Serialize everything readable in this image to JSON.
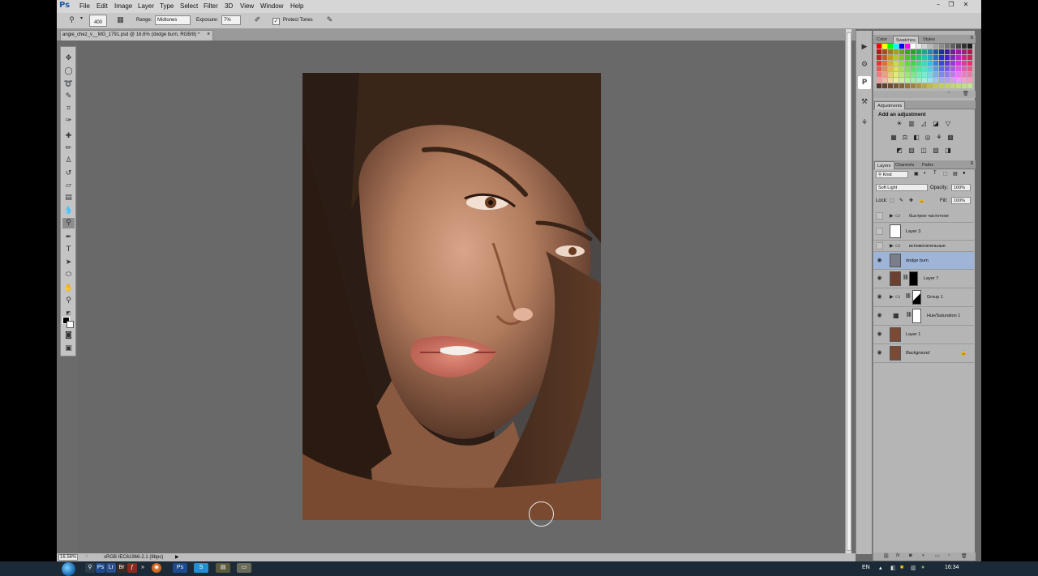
{
  "menu": {
    "logo": "Ps",
    "items": [
      "File",
      "Edit",
      "Image",
      "Layer",
      "Type",
      "Select",
      "Filter",
      "3D",
      "View",
      "Window",
      "Help"
    ],
    "window_buttons": [
      "–",
      "❐",
      "✕"
    ]
  },
  "options": {
    "brush_size": "400",
    "range_label": "Range:",
    "range_value": "Midtones",
    "exposure_label": "Exposure:",
    "exposure_value": "7%",
    "protect_tones_label": "Protect Tones",
    "protect_tones_checked": true
  },
  "document": {
    "tab_title": "angie_chez_v__MG_1791.psd @ 16,6% (dodge burn, RGB/8) *",
    "close": "×"
  },
  "status": {
    "zoom": "16.56%",
    "profile": "sRGB IEC61966-2.1 (8bpc)",
    "arrow": "▶"
  },
  "panels": {
    "color_tabs": [
      "Color",
      "Swatches",
      "Styles"
    ],
    "adjustments_tab": "Adjustments",
    "adjustments_heading": "Add an adjustment",
    "layers_tabs": [
      "Layers",
      "Channels",
      "Paths"
    ],
    "kind_filter": "Kind",
    "blend_mode": "Soft Light",
    "opacity_label": "Opacity:",
    "opacity_value": "100%",
    "lock_label": "Lock:",
    "fill_label": "Fill:",
    "fill_value": "100%",
    "layers": [
      {
        "name": "быстрое частотное",
        "type": "group",
        "visible": false
      },
      {
        "name": "Layer 3",
        "type": "layer",
        "visible": false
      },
      {
        "name": "вспомогательные",
        "type": "group",
        "visible": false
      },
      {
        "name": "dodge burn",
        "type": "layer",
        "visible": true,
        "selected": true
      },
      {
        "name": "Layer 7",
        "type": "layer",
        "visible": true
      },
      {
        "name": "Group 1",
        "type": "group",
        "visible": true
      },
      {
        "name": "Hue/Saturation 1",
        "type": "adjustment",
        "visible": true
      },
      {
        "name": "Layer 1",
        "type": "layer",
        "visible": true
      },
      {
        "name": "Background",
        "type": "layer",
        "visible": true,
        "locked": true
      }
    ]
  },
  "taskbar": {
    "language": "EN",
    "time": "16:34"
  },
  "colors": {
    "app_bg": "#6b6b6b",
    "panel_bg": "#b5b5b5",
    "selected_layer": "#9fb5d8"
  }
}
